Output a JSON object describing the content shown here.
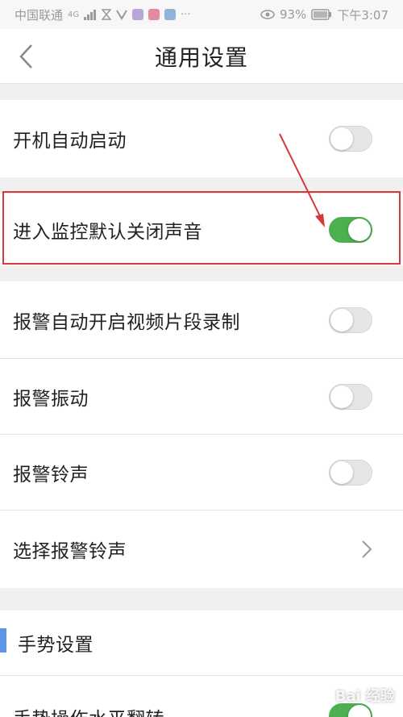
{
  "status_bar": {
    "carrier": "中国联通",
    "network": "4G",
    "battery": "93%",
    "time": "下午3:07"
  },
  "nav": {
    "title": "通用设置"
  },
  "settings": [
    {
      "label": "开机自动启动",
      "type": "toggle",
      "on": false
    },
    {
      "label": "进入监控默认关闭声音",
      "type": "toggle",
      "on": true
    },
    {
      "label": "报警自动开启视频片段录制",
      "type": "toggle",
      "on": false
    },
    {
      "label": "报警振动",
      "type": "toggle",
      "on": false
    },
    {
      "label": "报警铃声",
      "type": "toggle",
      "on": false
    },
    {
      "label": "选择报警铃声",
      "type": "link"
    }
  ],
  "section": {
    "title": "手势设置",
    "next_item_label": "手势操作水平翻转",
    "next_item_on": true
  },
  "watermark": "Bai 经验",
  "colors": {
    "toggle_on": "#4caf50",
    "toggle_off": "#e6e6e6",
    "highlight": "#d9383a",
    "section_accent": "#5b95e8"
  }
}
